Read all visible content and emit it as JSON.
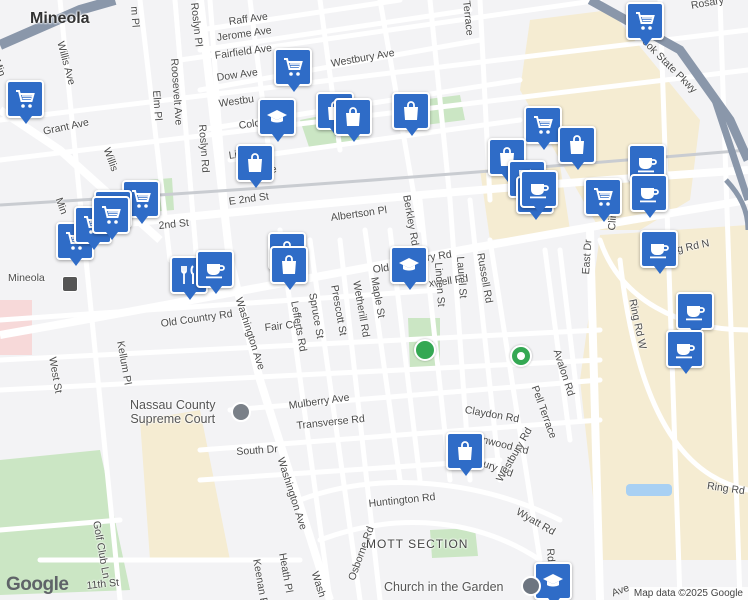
{
  "map": {
    "attribution": "Map data ©2025 Google",
    "logo": "Google",
    "colors": {
      "park": "#cbe6c4",
      "commercial": "#f5ecd2",
      "hospital": "#f7d9d9",
      "road": "#ffffff",
      "highway": "#8a97aa",
      "pin": "#2f6cc7"
    }
  },
  "labels": [
    {
      "id": "mineola",
      "text": "Mineola",
      "cls": "big"
    },
    {
      "id": "mineola-station",
      "text": "Mineola"
    },
    {
      "id": "raff",
      "text": "Raff Ave"
    },
    {
      "id": "jerome",
      "text": "Jerome Ave"
    },
    {
      "id": "fairfield",
      "text": "Fairfield Ave"
    },
    {
      "id": "dow",
      "text": "Dow Ave"
    },
    {
      "id": "westbury-ave-top",
      "text": "Westbury Ave"
    },
    {
      "id": "westbury-ave-2",
      "text": "Westbu"
    },
    {
      "id": "colonial",
      "text": "Colonial"
    },
    {
      "id": "liberty",
      "text": "Libe"
    },
    {
      "id": "liberty-2",
      "text": "e"
    },
    {
      "id": "grant",
      "text": "Grant Ave"
    },
    {
      "id": "willis-ave-top",
      "text": "Willis Ave"
    },
    {
      "id": "willis-ave-mid",
      "text": "Willis"
    },
    {
      "id": "elm-pl-top",
      "text": "m Pl"
    },
    {
      "id": "elm-pl",
      "text": "Elm Pl"
    },
    {
      "id": "roosevelt",
      "text": "Roosevelt Ave"
    },
    {
      "id": "roslyn-top",
      "text": "Roslyn Pl"
    },
    {
      "id": "roslyn",
      "text": "Roslyn Rd"
    },
    {
      "id": "e2nd",
      "text": "E 2nd St"
    },
    {
      "id": "2nd",
      "text": "2nd St"
    },
    {
      "id": "albertson",
      "text": "Albertson Pl"
    },
    {
      "id": "berkley",
      "text": "Berkley Rd"
    },
    {
      "id": "old-country-1",
      "text": "Old Country Rd"
    },
    {
      "id": "old-country-2",
      "text": "Old Co"
    },
    {
      "id": "old-country-3",
      "text": "ry Rd"
    },
    {
      "id": "maxwell",
      "text": "xwell Rd"
    },
    {
      "id": "linden",
      "text": "Linden St"
    },
    {
      "id": "laurel",
      "text": "Laurel St"
    },
    {
      "id": "russell",
      "text": "Russell Rd"
    },
    {
      "id": "clinton",
      "text": "Clinton Rd"
    },
    {
      "id": "east-dr",
      "text": "East Dr"
    },
    {
      "id": "ring-rd-n",
      "text": "g Rd N"
    },
    {
      "id": "ring-rd-w",
      "text": "Ring Rd W"
    },
    {
      "id": "ring-rd",
      "text": "Ring Rd"
    },
    {
      "id": "parkway",
      "text": "ook State Pkwy"
    },
    {
      "id": "fair-ct",
      "text": "Fair Ct"
    },
    {
      "id": "lefferts",
      "text": "Lefferts Rd"
    },
    {
      "id": "spruce",
      "text": "Spruce St"
    },
    {
      "id": "prescott",
      "text": "Prescott St"
    },
    {
      "id": "wetherill",
      "text": "Wetherill Rd"
    },
    {
      "id": "maple",
      "text": "Maple St"
    },
    {
      "id": "washington-1",
      "text": "Washington Ave"
    },
    {
      "id": "washington-2",
      "text": "Washington Ave"
    },
    {
      "id": "washington-3",
      "text": "Wash"
    },
    {
      "id": "kellum",
      "text": "Kellum Pl"
    },
    {
      "id": "west-st",
      "text": "West St"
    },
    {
      "id": "mineola-blvd",
      "text": "Min"
    },
    {
      "id": "minel",
      "text": "Min"
    },
    {
      "id": "mulberry",
      "text": "Mulberry Ave"
    },
    {
      "id": "transverse",
      "text": "Transverse Rd"
    },
    {
      "id": "south-dr",
      "text": "South Dr"
    },
    {
      "id": "claydon",
      "text": "Claydon Rd"
    },
    {
      "id": "glenwood",
      "text": "lenwood Rd"
    },
    {
      "id": "westbury-rd",
      "text": "bury Rd"
    },
    {
      "id": "westbury-rd-2",
      "text": "Westbury Rd"
    },
    {
      "id": "wyatt",
      "text": "Wyatt Rd"
    },
    {
      "id": "pell",
      "text": "Pell Terrace"
    },
    {
      "id": "avalon",
      "text": "Avalon Rd"
    },
    {
      "id": "terrace-top",
      "text": "Terrace"
    },
    {
      "id": "rosary",
      "text": "Rosary"
    },
    {
      "id": "huntington",
      "text": "Huntington Rd"
    },
    {
      "id": "osborne",
      "text": "Osborne Rd"
    },
    {
      "id": "golf-club",
      "text": "Golf Club Ln"
    },
    {
      "id": "11th",
      "text": "11th St"
    },
    {
      "id": "keenan",
      "text": "Keenan P"
    },
    {
      "id": "heath",
      "text": "Heath Pl"
    },
    {
      "id": "mott",
      "text": "MOTT SECTION",
      "cls": "area"
    },
    {
      "id": "church",
      "text": "Church in the Garden",
      "cls": "poi"
    },
    {
      "id": "court",
      "text": "Nassau County\nSupreme Court",
      "cls": "poi"
    },
    {
      "id": "rd-bottom",
      "text": "Rd"
    },
    {
      "id": "ave-bottom",
      "text": "Ave"
    }
  ],
  "pins": [
    {
      "id": "p1",
      "icon": "cart-icon"
    },
    {
      "id": "p2",
      "icon": "cart-icon"
    },
    {
      "id": "p3",
      "icon": "cart-icon"
    },
    {
      "id": "p4",
      "icon": "graduation-cap-icon"
    },
    {
      "id": "p5",
      "icon": "bag-icon"
    },
    {
      "id": "p6",
      "icon": "bag-icon"
    },
    {
      "id": "p7",
      "icon": "bag-icon"
    },
    {
      "id": "p8",
      "icon": "bag-icon"
    },
    {
      "id": "p9",
      "icon": "cart-icon"
    },
    {
      "id": "p10",
      "icon": "bag-icon"
    },
    {
      "id": "p11",
      "icon": "bag-icon"
    },
    {
      "id": "p12",
      "icon": "coffee-icon"
    },
    {
      "id": "p13",
      "icon": "fork-knife-icon"
    },
    {
      "id": "p14",
      "icon": "fork-knife-icon"
    },
    {
      "id": "p15",
      "icon": "cart-icon"
    },
    {
      "id": "p16",
      "icon": "coffee-icon"
    },
    {
      "id": "p17",
      "icon": "coffee-icon"
    },
    {
      "id": "p18",
      "icon": "coffee-icon"
    },
    {
      "id": "p19",
      "icon": "coffee-icon"
    },
    {
      "id": "p20",
      "icon": "cart-icon"
    },
    {
      "id": "p21",
      "icon": "cart-icon"
    },
    {
      "id": "p22",
      "icon": "bag-icon"
    },
    {
      "id": "p23",
      "icon": "cart-icon"
    },
    {
      "id": "p24",
      "icon": "fork-knife-icon"
    },
    {
      "id": "p25",
      "icon": "coffee-icon"
    },
    {
      "id": "p26",
      "icon": "bag-icon"
    },
    {
      "id": "p27",
      "icon": "coffee-icon"
    },
    {
      "id": "p28",
      "icon": "graduation-cap-icon"
    },
    {
      "id": "p29",
      "icon": "bag-icon"
    },
    {
      "id": "p30",
      "icon": "graduation-cap-icon"
    },
    {
      "id": "p31",
      "icon": "cart-icon"
    },
    {
      "id": "p32",
      "icon": "coffee-icon"
    }
  ]
}
